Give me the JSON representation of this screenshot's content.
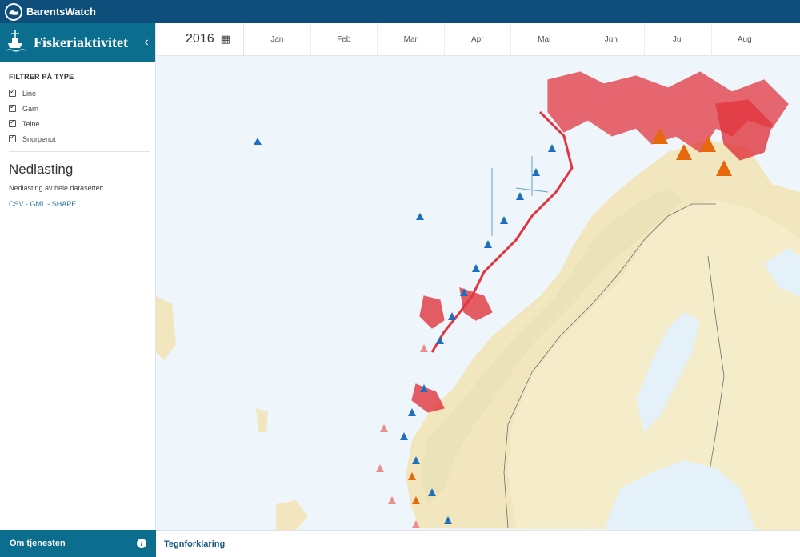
{
  "app": {
    "brand": "BarentsWatch"
  },
  "sidebar": {
    "title": "Fiskeriaktivitet",
    "filter_title": "FILTRER PÅ TYPE",
    "filters": [
      {
        "label": "Line",
        "checked": true
      },
      {
        "label": "Garn",
        "checked": true
      },
      {
        "label": "Teine",
        "checked": true
      },
      {
        "label": "Snurpenot",
        "checked": true
      }
    ],
    "download_title": "Nedlasting",
    "download_subtitle": "Nedlasting av hele datasettet:",
    "download_links": [
      "CSV",
      "GML",
      "SHAPE"
    ],
    "about_label": "Om tjenesten"
  },
  "timeline": {
    "year": "2016",
    "months": [
      "Jan",
      "Feb",
      "Mar",
      "Apr",
      "Mai",
      "Jun",
      "Jul",
      "Aug"
    ]
  },
  "legend": {
    "label": "Tegnforklaring"
  },
  "colors": {
    "line": "#1e6fbd",
    "garn": "#e0202a",
    "teine": "#e5680d",
    "snurpenot": "#ec8c8c",
    "header": "#0d4f7a",
    "accent": "#0b6e8e"
  }
}
